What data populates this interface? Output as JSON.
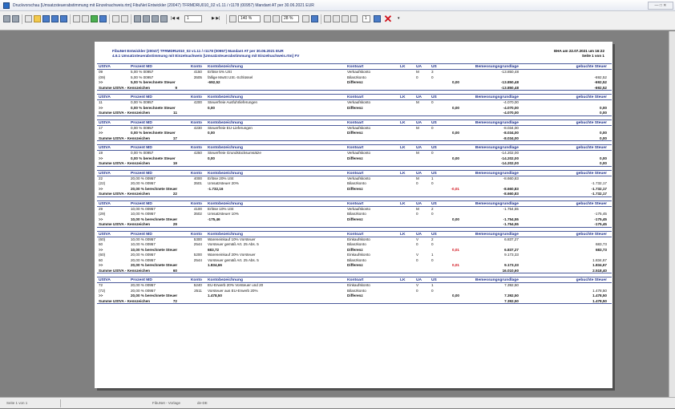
{
  "window": {
    "title": "Druckvorschau [Umsatzsteuerabstimmung mit Einzelnachweis.rtm] FibuNet Entwickler (20047) TFRMDRU010_02 v1.11 / r1178 (00957) Mandant AT  per 30.06.2021 EUR",
    "controls": "— □ ✕"
  },
  "toolbar": {
    "page_input": "1",
    "zoom_value": "140 %",
    "zoom2_value": "28 %",
    "copies_value": "1"
  },
  "report": {
    "header_line1": "FibuNet Entwickler (20047) TFRMDRU010_02 v1.11 / r1178 (00957) Mandant AT   per 30.06.2021 EUR",
    "header_line2": "4.6.1 Umsatzsteuerabstimmung mit Einzelnachweis       [Umsatzsteuerabstimmung mit Einzelnachweis.rtm] FV",
    "header_right1": "EHA  am  22.07.2021 um  16:22",
    "header_right2": "Seite 1 von 1",
    "columns": {
      "ustva": "UStVA",
      "prozent_md": "Prozent  MD",
      "konto": "Konto",
      "kontobezeichnung": "Kontobezeichnung",
      "kontoart": "Kontoart",
      "lk": "LK",
      "ua": "UA",
      "us": "US",
      "bemessungsgrundlage": "Bemessungsgrundlage",
      "gebuchte_steuer": "gebuchte Steuer"
    },
    "blocks": [
      {
        "rows": [
          {
            "ustva": "09",
            "prozent": "5,00 %  00957",
            "konto": "4150",
            "bez": "Erlöse 5% USt",
            "kontoart": "Verkaufskonto",
            "ua": "M",
            "us": "3",
            "bem": "-13.850,48",
            "geb": ""
          },
          {
            "ustva": "(09)",
            "prozent": "5,00 %  00957",
            "konto": "3505",
            "bez": "fällige MwSt  USt.-Schlüssel",
            "kontoart": "Bilanzkonto",
            "ua": "0",
            "us": "0",
            "bem": "",
            "geb": "-692,52"
          }
        ],
        "total": {
          "marker": ">>",
          "label": "5,00 % berechnete Steuer",
          "steuer": "-692,52",
          "diff_label": "Differenz",
          "diff": "0,00",
          "diff_red": false,
          "bem": "-13.850,48",
          "geb": "-692,52"
        },
        "sum": {
          "label": "Summe UStVA - Kennzeichen",
          "kz": "9",
          "bem": "-13.850,48",
          "geb": "-692,52"
        }
      },
      {
        "rows": [
          {
            "ustva": "11",
            "prozent": "0,00 %  00957",
            "konto": "4200",
            "bez": "Steuerfreie Ausfuhrlieferungen",
            "kontoart": "Verkaufskonto",
            "ua": "M",
            "us": "0",
            "bem": "-4.070,00",
            "geb": ""
          }
        ],
        "total": {
          "marker": ">>",
          "label": "0,00 % berechnete Steuer",
          "steuer": "0,00",
          "diff_label": "Differenz",
          "diff": "0,00",
          "diff_red": false,
          "bem": "-4.070,00",
          "geb": "0,00"
        },
        "sum": {
          "label": "Summe UStVA - Kennzeichen",
          "kz": "11",
          "bem": "-4.070,00",
          "geb": "0,00"
        }
      },
      {
        "rows": [
          {
            "ustva": "17",
            "prozent": "0,00 %  00957",
            "konto": "4230",
            "bez": "Steuerfreie EU-Lieferungen",
            "kontoart": "Verkaufskonto",
            "ua": "M",
            "us": "0",
            "bem": "-8.034,00",
            "geb": ""
          }
        ],
        "total": {
          "marker": ">>",
          "label": "0,00 % berechnete Steuer",
          "steuer": "0,00",
          "diff_label": "Differenz",
          "diff": "0,00",
          "diff_red": false,
          "bem": "-8.034,00",
          "geb": "0,00"
        },
        "sum": {
          "label": "Summe UStVA - Kennzeichen",
          "kz": "17",
          "bem": "-8.034,00",
          "geb": "0,00"
        }
      },
      {
        "rows": [
          {
            "ustva": "19",
            "prozent": "0,00 %  00957",
            "konto": "4250",
            "bez": "Steuerfreie Grundstücksumsätze",
            "kontoart": "Verkaufskonto",
            "ua": "M",
            "us": "0",
            "bem": "-14.202,00",
            "geb": ""
          }
        ],
        "total": {
          "marker": ">>",
          "label": "0,00 % berechnete Steuer",
          "steuer": "0,00",
          "diff_label": "Differenz",
          "diff": "0,00",
          "diff_red": false,
          "bem": "-14.202,00",
          "geb": "0,00"
        },
        "sum": {
          "label": "Summe UStVA - Kennzeichen",
          "kz": "19",
          "bem": "-14.202,00",
          "geb": "0,00"
        }
      },
      {
        "rows": [
          {
            "ustva": "22",
            "prozent": "20,00 %  00957",
            "konto": "4000",
            "bez": "Erlöse 20% USt",
            "kontoart": "Verkaufskonto",
            "ua": "M",
            "us": "1",
            "bem": "-8.660,83",
            "geb": ""
          },
          {
            "ustva": "(22)",
            "prozent": "20,00 %  00957",
            "konto": "3501",
            "bez": "Umsatzsteuer 20%",
            "kontoart": "Bilanzkonto",
            "ua": "0",
            "us": "0",
            "bem": "",
            "geb": "-1.732,17"
          }
        ],
        "total": {
          "marker": ">>",
          "label": "20,00 % berechnete Steuer",
          "steuer": "-1.732,16",
          "diff_label": "Differenz",
          "diff": "-0,01",
          "diff_red": true,
          "bem": "-8.660,83",
          "geb": "-1.732,17"
        },
        "sum": {
          "label": "Summe UStVA - Kennzeichen",
          "kz": "22",
          "bem": "-8.660,83",
          "geb": "-1.732,17"
        }
      },
      {
        "rows": [
          {
            "ustva": "29",
            "prozent": "10,00 %  00957",
            "konto": "4100",
            "bez": "Erlöse 10% USt",
            "kontoart": "Verkaufskonto",
            "ua": "M",
            "us": "2",
            "bem": "-1.754,55",
            "geb": ""
          },
          {
            "ustva": "(29)",
            "prozent": "10,00 %  00957",
            "konto": "3502",
            "bez": "Umsatzsteuer 10%",
            "kontoart": "Bilanzkonto",
            "ua": "0",
            "us": "0",
            "bem": "",
            "geb": "-175,45"
          }
        ],
        "total": {
          "marker": ">>",
          "label": "10,00 % berechnete Steuer",
          "steuer": "-175,46",
          "diff_label": "Differenz",
          "diff": "0,00",
          "diff_red": false,
          "bem": "-1.754,55",
          "geb": "-175,45"
        },
        "sum": {
          "label": "Summe UStVA - Kennzeichen",
          "kz": "29",
          "bem": "-1.754,55",
          "geb": "-175,45"
        }
      },
      {
        "rows": [
          {
            "ustva": "(60)",
            "prozent": "10,00 %  00957",
            "konto": "5300",
            "bez": "Wareneinkauf 10% Vorsteuer",
            "kontoart": "Einkaufskonto",
            "ua": "V",
            "us": "2",
            "bem": "6.837,27",
            "geb": ""
          },
          {
            "ustva": "60",
            "prozent": "10,00 %  00957",
            "konto": "2544",
            "bez": "Vorsteuer gemäß Art. 25 Abs. 5",
            "kontoart": "Bilanzkonto",
            "ua": "0",
            "us": "0",
            "bem": "",
            "geb": "683,73"
          },
          {
            "ustva": ">>",
            "prozent": "10,00 % berechnete Steuer",
            "konto": "",
            "bez": "683,72",
            "kontoart": "Differenz",
            "ua": "",
            "us": "",
            "bem": "6.837,27",
            "geb": "683,73",
            "is_total": true,
            "diff": "0,01",
            "diff_red": true
          },
          {
            "ustva": "(60)",
            "prozent": "20,00 %  00957",
            "konto": "5200",
            "bez": "Wareneinkauf 20% Vorsteuer",
            "kontoart": "Einkaufskonto",
            "ua": "V",
            "us": "1",
            "bem": "9.173,33",
            "geb": ""
          },
          {
            "ustva": "60",
            "prozent": "20,00 %  00957",
            "konto": "2544",
            "bez": "Vorsteuer gemäß Art. 25 Abs. 5",
            "kontoart": "Bilanzkonto",
            "ua": "0",
            "us": "0",
            "bem": "",
            "geb": "1.834,67"
          }
        ],
        "total": {
          "marker": ">>",
          "label": "20,00 % berechnete Steuer",
          "steuer": "1.834,66",
          "diff_label": "Differenz",
          "diff": "0,01",
          "diff_red": true,
          "bem": "9.173,33",
          "geb": "1.834,67"
        },
        "sum": {
          "label": "Summe UStVA - Kennzeichen",
          "kz": "60",
          "bem": "16.010,60",
          "geb": "2.518,40"
        }
      },
      {
        "rows": [
          {
            "ustva": "72",
            "prozent": "20,00 %  00957",
            "konto": "5240",
            "bez": "EU-Erwerb 20% Vorsteuer und 20",
            "kontoart": "Einkaufskonto",
            "ua": "V",
            "us": "1",
            "bem": "7.392,50",
            "geb": ""
          },
          {
            "ustva": "(72)",
            "prozent": "20,00 %  00957",
            "konto": "2511",
            "bez": "Vorsteuer aus EU-Erwerb 20%",
            "kontoart": "Bilanzkonto",
            "ua": "0",
            "us": "0",
            "bem": "",
            "geb": "1.478,50"
          }
        ],
        "total": {
          "marker": ">>",
          "label": "20,00 % berechnete Steuer",
          "steuer": "1.478,50",
          "diff_label": "Differenz",
          "diff": "0,00",
          "diff_red": false,
          "bem": "7.392,50",
          "geb": "1.478,50"
        },
        "sum": {
          "label": "Summe UStVA - Kennzeichen",
          "kz": "72",
          "bem": "7.392,50",
          "geb": "1.478,50"
        }
      }
    ]
  },
  "statusbar": {
    "page_info": "Seite 1 von 1",
    "template": "FibuNet - Vorlage",
    "lang": "de-DE"
  }
}
